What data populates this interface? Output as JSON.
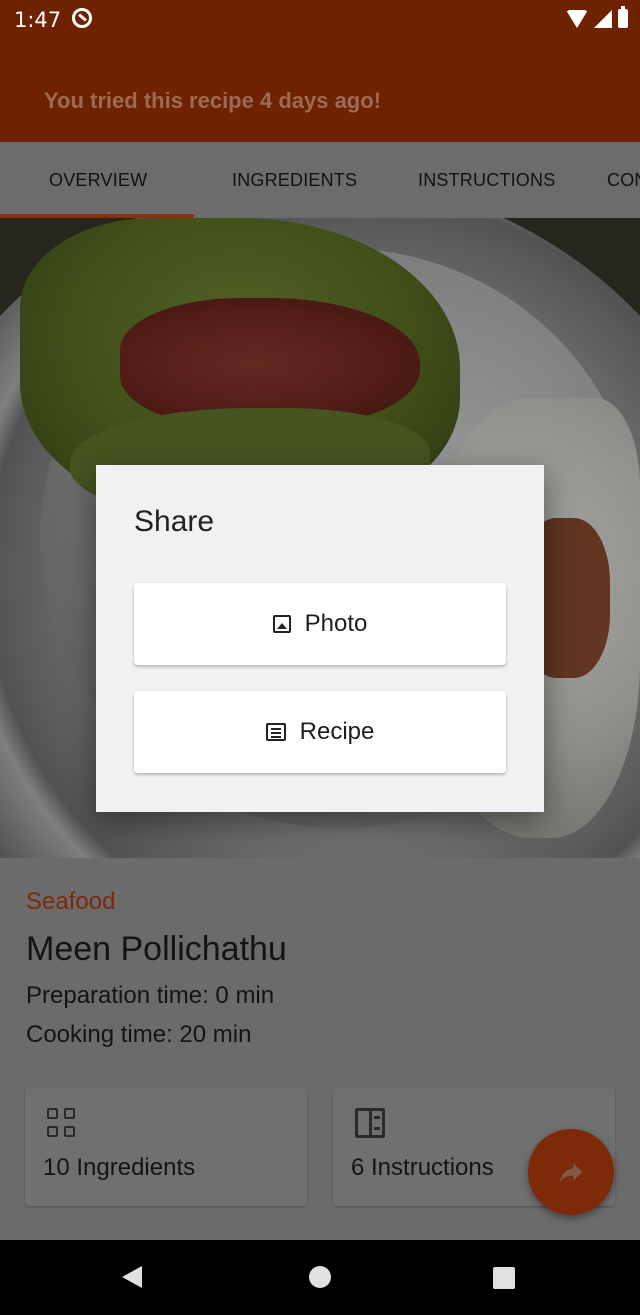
{
  "status_bar": {
    "time": "1:47"
  },
  "banner": {
    "text": "You tried this recipe 4 days ago!"
  },
  "tabs": [
    {
      "label": "OVERVIEW",
      "selected": true
    },
    {
      "label": "INGREDIENTS"
    },
    {
      "label": "INSTRUCTIONS"
    },
    {
      "label": "CON"
    }
  ],
  "recipe": {
    "category": "Seafood",
    "title": "Meen Pollichathu",
    "prep_time": "Preparation time: 0 min",
    "cook_time": "Cooking time: 20 min",
    "ingredients_card": "10 Ingredients",
    "instructions_card": "6 Instructions"
  },
  "dialog": {
    "title": "Share",
    "photo_label": "Photo",
    "recipe_label": "Recipe"
  },
  "colors": {
    "brand": "#6e2200",
    "accent": "#8a2f0d"
  },
  "icons": [
    "dnd-icon",
    "wifi-icon",
    "cell-icon",
    "battery-icon",
    "image-icon",
    "document-icon",
    "grid-icon",
    "book-icon",
    "share-arrow-icon",
    "back-icon",
    "home-icon",
    "recents-icon"
  ]
}
